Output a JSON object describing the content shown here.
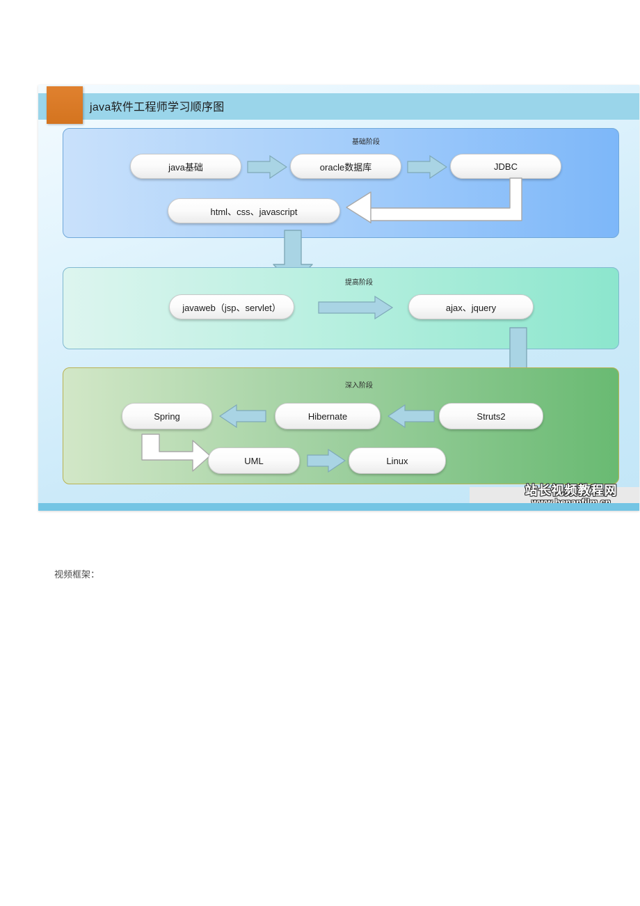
{
  "page": {
    "caption": "视频框架："
  },
  "slide": {
    "title": "java软件工程师学习顺序图",
    "colors": {
      "title_band": "#9ad5ea",
      "title_square": "#d4741f",
      "bottom_bar": "#74c5e4",
      "slide_bg": "#cceaf9",
      "stage1_from": "#c9e1fb",
      "stage1_to": "#7db7f9",
      "stage2_from": "#ddf5ef",
      "stage2_to": "#8ce6cd",
      "stage3_from": "#d2e7c7",
      "stage3_to": "#69ba72",
      "arrow_fill": "#a9d4e4",
      "elbow_fill": "#ffffff",
      "node_fill": "#fbfbfb"
    },
    "stages": [
      {
        "id": "stage-1",
        "label": "基础阶段",
        "nodes": [
          {
            "id": "java-basics",
            "text": "java基础"
          },
          {
            "id": "oracle-db",
            "text": "oracle数据库"
          },
          {
            "id": "jdbc",
            "text": "JDBC"
          },
          {
            "id": "html-css-js",
            "text": "html、css、javascript"
          }
        ]
      },
      {
        "id": "stage-2",
        "label": "提高阶段",
        "nodes": [
          {
            "id": "javaweb",
            "text": "javaweb（jsp、servlet）"
          },
          {
            "id": "ajax-jquery",
            "text": "ajax、jquery"
          }
        ]
      },
      {
        "id": "stage-3",
        "label": "深入阶段",
        "nodes": [
          {
            "id": "spring",
            "text": "Spring"
          },
          {
            "id": "hibernate",
            "text": "Hibernate"
          },
          {
            "id": "struts2",
            "text": "Struts2"
          },
          {
            "id": "uml",
            "text": "UML"
          },
          {
            "id": "linux",
            "text": "Linux"
          }
        ]
      }
    ],
    "flow": [
      {
        "from": "java基础",
        "to": "oracle数据库",
        "direction": "right"
      },
      {
        "from": "oracle数据库",
        "to": "JDBC",
        "direction": "right"
      },
      {
        "from": "JDBC",
        "to": "html、css、javascript",
        "direction": "elbow-left"
      },
      {
        "from": "基础阶段",
        "to": "提高阶段",
        "direction": "down"
      },
      {
        "from": "javaweb（jsp、servlet）",
        "to": "ajax、jquery",
        "direction": "right"
      },
      {
        "from": "ajax、jquery",
        "to": "Struts2",
        "direction": "down"
      },
      {
        "from": "Struts2",
        "to": "Hibernate",
        "direction": "left"
      },
      {
        "from": "Hibernate",
        "to": "Spring",
        "direction": "left"
      },
      {
        "from": "Spring",
        "to": "UML",
        "direction": "elbow-right"
      },
      {
        "from": "UML",
        "to": "Linux",
        "direction": "right"
      }
    ]
  },
  "watermark": {
    "cn": "站长视频教程网",
    "url": "www.henanfilm.cn"
  }
}
